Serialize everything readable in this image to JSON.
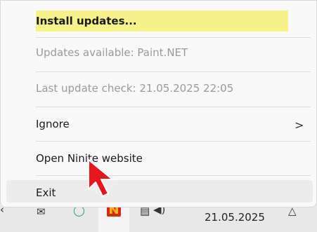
{
  "menu": {
    "install_label": "Install updates...",
    "updates_available": "Updates available: Paint.NET",
    "last_check": "Last update check: 21.05.2025 22:05",
    "ignore_label": "Ignore",
    "ignore_arrow": ">",
    "website_label": "Open Ninite website",
    "exit_label": "Exit"
  },
  "taskbar": {
    "date": "21.05.2025"
  },
  "colors": {
    "highlight": "#f5f28a",
    "ninite_red": "#d42a14",
    "cursor_red": "#e8141e"
  },
  "icons": [
    "chevron-right-icon",
    "mouse-cursor-icon",
    "ninite-icon",
    "mail-icon",
    "app-icon",
    "network-icon",
    "volume-icon",
    "bell-icon"
  ]
}
